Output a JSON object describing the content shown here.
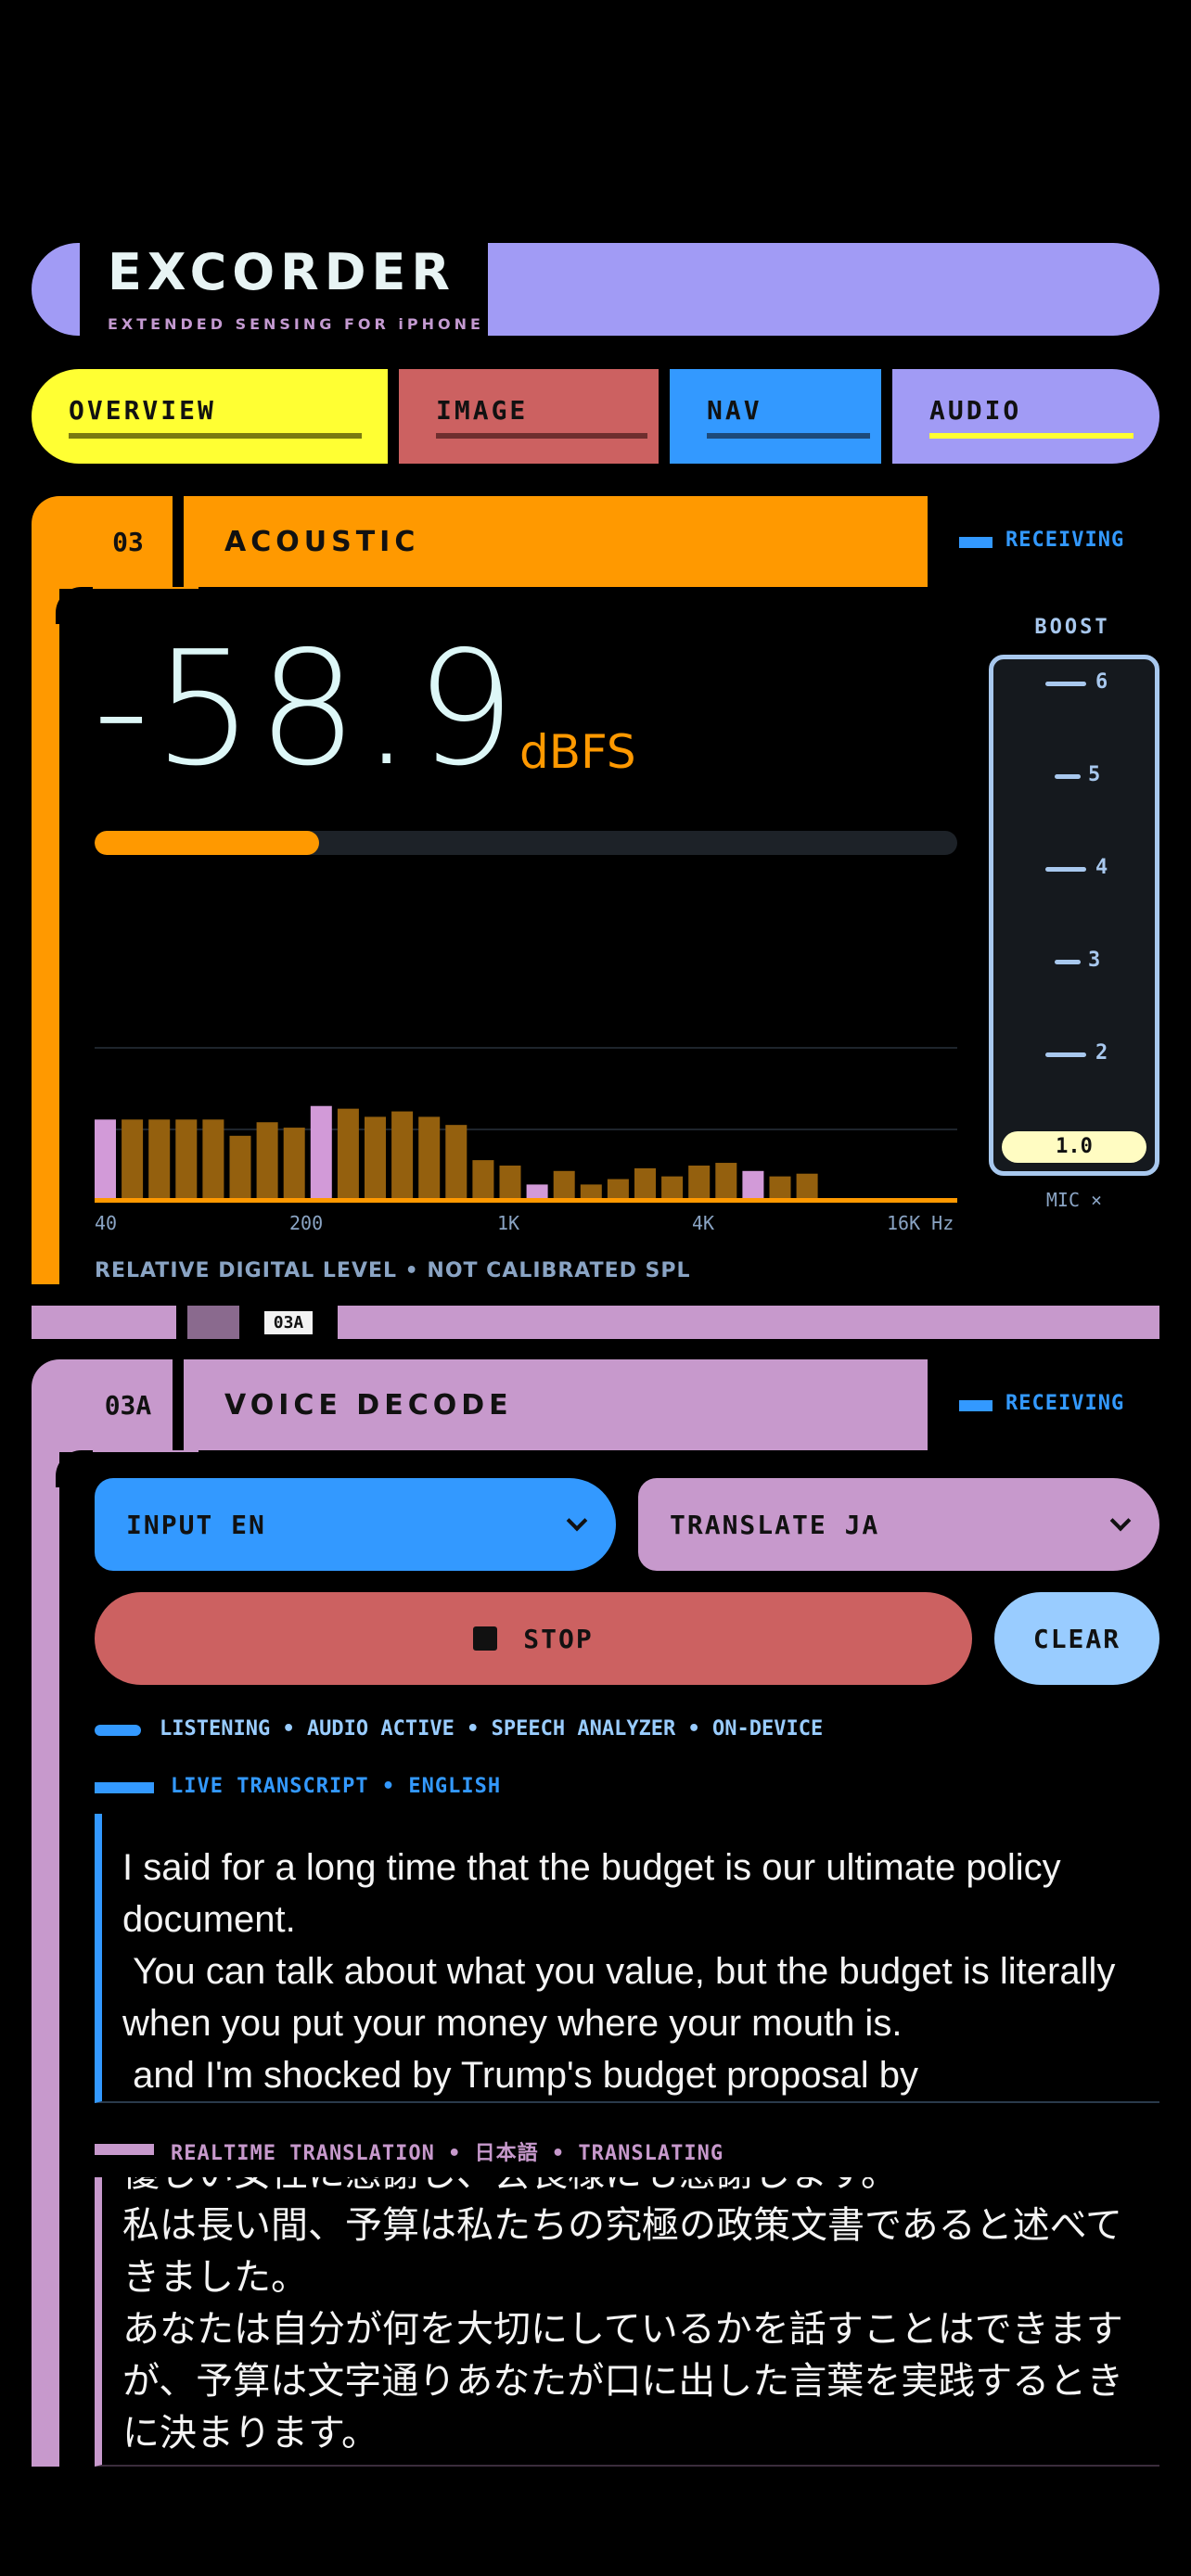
{
  "app": {
    "title": "EXCORDER",
    "subtitle": "EXTENDED SENSING FOR iPHONE"
  },
  "tabs": [
    {
      "label": "OVERVIEW",
      "color": "#ffff33",
      "bar_color": "#7a7a10"
    },
    {
      "label": "IMAGE",
      "color": "#cc6161",
      "bar_color": "#6e2e2e"
    },
    {
      "label": "NAV",
      "color": "#3399ff",
      "bar_color": "#1d4a7a"
    },
    {
      "label": "AUDIO",
      "color": "#a19bf5",
      "bar_color": "#ffff33"
    }
  ],
  "acoustic": {
    "code": "03",
    "title": "ACOUSTIC",
    "status": "RECEIVING",
    "level_value": "-58.9",
    "level_unit": "dBFS",
    "level_fraction": 0.26,
    "freq_ticks": [
      "40",
      "200",
      "1K",
      "4K",
      "16K Hz"
    ],
    "footnote": "RELATIVE DIGITAL LEVEL • NOT CALIBRATED SPL",
    "spectrum": [
      {
        "value": 0.29,
        "highlight": true
      },
      {
        "value": 0.29,
        "highlight": false
      },
      {
        "value": 0.29,
        "highlight": false
      },
      {
        "value": 0.29,
        "highlight": false
      },
      {
        "value": 0.29,
        "highlight": false
      },
      {
        "value": 0.23,
        "highlight": false
      },
      {
        "value": 0.28,
        "highlight": false
      },
      {
        "value": 0.26,
        "highlight": false
      },
      {
        "value": 0.34,
        "highlight": true
      },
      {
        "value": 0.33,
        "highlight": false
      },
      {
        "value": 0.3,
        "highlight": false
      },
      {
        "value": 0.32,
        "highlight": false
      },
      {
        "value": 0.3,
        "highlight": false
      },
      {
        "value": 0.27,
        "highlight": false
      },
      {
        "value": 0.14,
        "highlight": false
      },
      {
        "value": 0.12,
        "highlight": false
      },
      {
        "value": 0.05,
        "highlight": true
      },
      {
        "value": 0.1,
        "highlight": false
      },
      {
        "value": 0.05,
        "highlight": false
      },
      {
        "value": 0.07,
        "highlight": false
      },
      {
        "value": 0.11,
        "highlight": false
      },
      {
        "value": 0.08,
        "highlight": false
      },
      {
        "value": 0.12,
        "highlight": false
      },
      {
        "value": 0.13,
        "highlight": false
      },
      {
        "value": 0.1,
        "highlight": true
      },
      {
        "value": 0.08,
        "highlight": false
      },
      {
        "value": 0.09,
        "highlight": false
      }
    ],
    "boost": {
      "label": "BOOST",
      "ticks": [
        "6",
        "5",
        "4",
        "3",
        "2"
      ],
      "value": "1.0",
      "mic_label": "MIC ×"
    }
  },
  "divider": {
    "tag": "03A"
  },
  "voice": {
    "code": "03A",
    "title": "VOICE DECODE",
    "status": "RECEIVING",
    "input_label": "INPUT EN",
    "translate_label": "TRANSLATE JA",
    "stop_label": "STOP",
    "clear_label": "CLEAR",
    "status_line": "LISTENING • AUDIO ACTIVE • SPEECH ANALYZER • ON-DEVICE",
    "transcript_heading": "LIVE TRANSCRIPT • ENGLISH",
    "transcript": "I said for a long time that the budget is our ultimate policy document.\n You can talk about what you value, but the budget is literally when you put your money where your mouth is.\n and I'm shocked by Trump's budget proposal by",
    "translation_heading": "REALTIME TRANSLATION • 日本語 • TRANSLATING",
    "translation": "優しい女性に感謝し、会長様にも感謝します。\n私は長い間、予算は私たちの究極の政策文書であると述べてきました。\nあなたは自分が何を大切にしているかを話すことはできますが、予算は文字通りあなたが口に出した言葉を実践するときに決まります。"
  },
  "colors": {
    "orange": "#ff9900",
    "lilac": "#c799cc",
    "blue": "#3399ff",
    "periwinkle": "#a19bf5",
    "yellow": "#ffff33",
    "red": "#cc6161"
  }
}
